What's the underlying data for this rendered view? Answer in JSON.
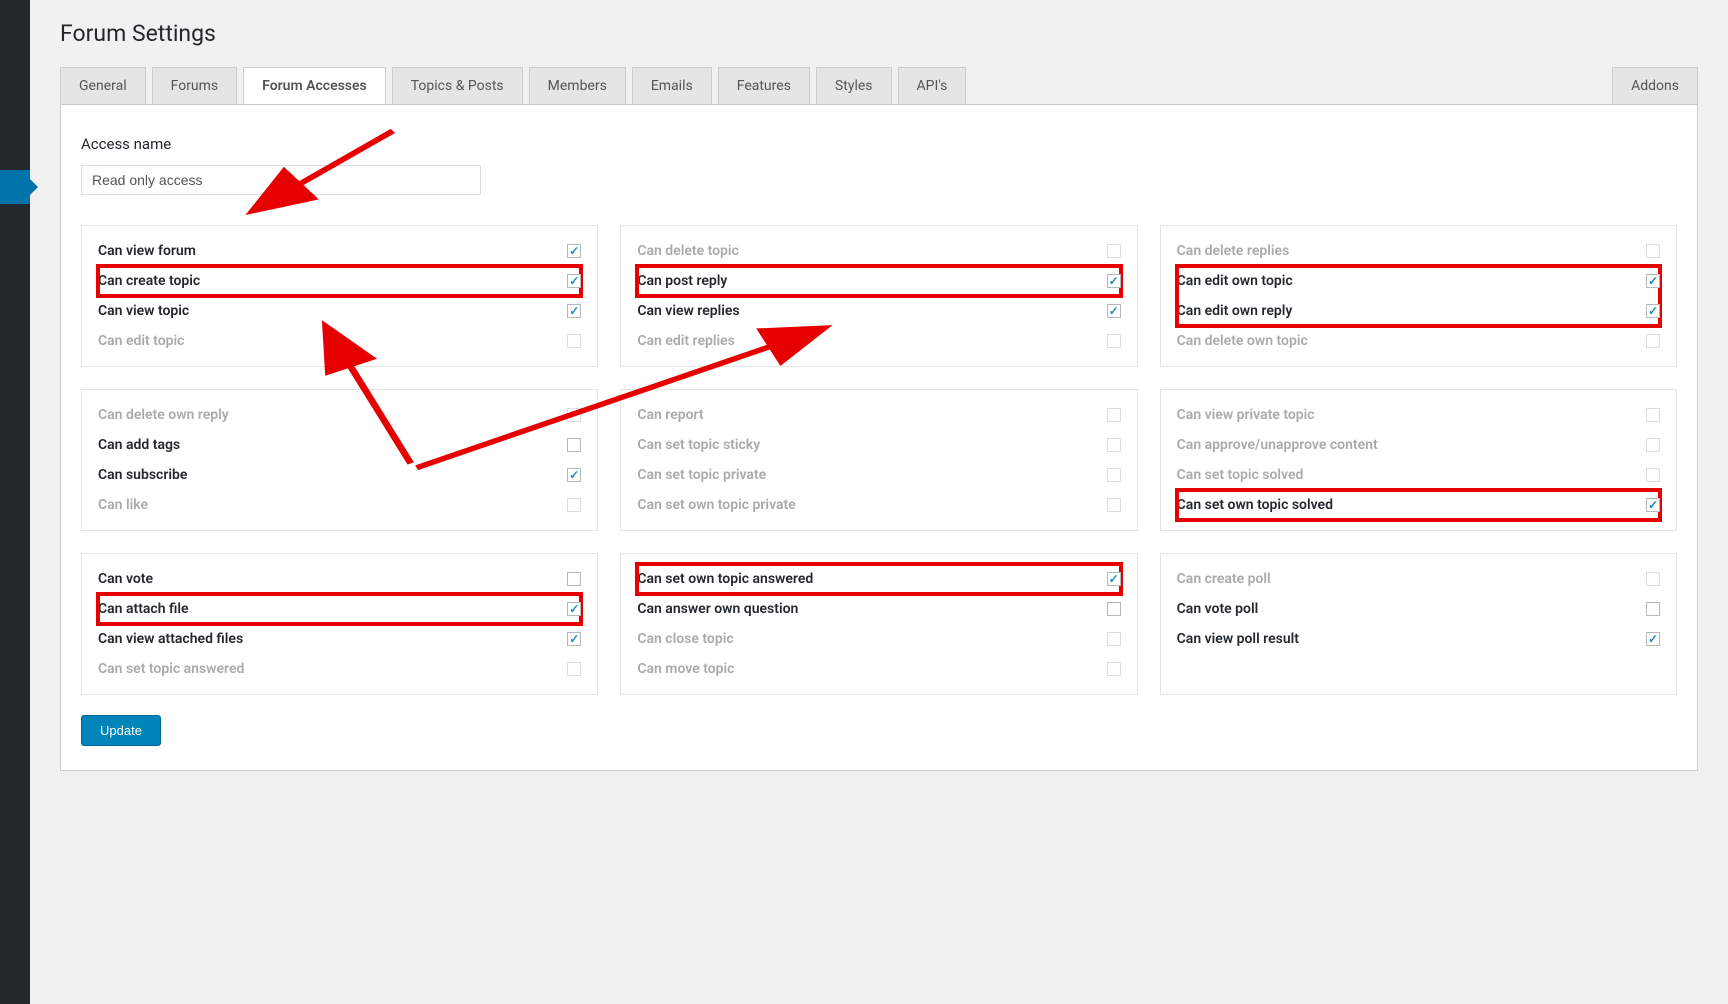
{
  "page_title": "Forum Settings",
  "tabs": {
    "general": "General",
    "forums": "Forums",
    "forum_accesses": "Forum Accesses",
    "topics_posts": "Topics & Posts",
    "members": "Members",
    "emails": "Emails",
    "features": "Features",
    "styles": "Styles",
    "apis": "API's",
    "addons": "Addons"
  },
  "access_name_label": "Access name",
  "access_name_value": "Read only access",
  "cards": [
    [
      {
        "label": "Can view forum",
        "checked": true,
        "enabled": true,
        "highlight": false
      },
      {
        "label": "Can create topic",
        "checked": true,
        "enabled": true,
        "highlight": true
      },
      {
        "label": "Can view topic",
        "checked": true,
        "enabled": true,
        "highlight": false
      },
      {
        "label": "Can edit topic",
        "checked": false,
        "enabled": false,
        "highlight": false
      }
    ],
    [
      {
        "label": "Can delete topic",
        "checked": false,
        "enabled": false,
        "highlight": false
      },
      {
        "label": "Can post reply",
        "checked": true,
        "enabled": true,
        "highlight": true
      },
      {
        "label": "Can view replies",
        "checked": true,
        "enabled": true,
        "highlight": false
      },
      {
        "label": "Can edit replies",
        "checked": false,
        "enabled": false,
        "highlight": false
      }
    ],
    [
      {
        "label": "Can delete replies",
        "checked": false,
        "enabled": false,
        "highlight": false
      },
      {
        "label": "Can edit own topic",
        "checked": true,
        "enabled": true,
        "highlight": true
      },
      {
        "label": "Can edit own reply",
        "checked": true,
        "enabled": true,
        "highlight": true
      },
      {
        "label": "Can delete own topic",
        "checked": false,
        "enabled": false,
        "highlight": false
      }
    ],
    [
      {
        "label": "Can delete own reply",
        "checked": false,
        "enabled": false,
        "highlight": false
      },
      {
        "label": "Can add tags",
        "checked": false,
        "enabled": true,
        "highlight": false
      },
      {
        "label": "Can subscribe",
        "checked": true,
        "enabled": true,
        "highlight": false
      },
      {
        "label": "Can like",
        "checked": false,
        "enabled": false,
        "highlight": false
      }
    ],
    [
      {
        "label": "Can report",
        "checked": false,
        "enabled": false,
        "highlight": false
      },
      {
        "label": "Can set topic sticky",
        "checked": false,
        "enabled": false,
        "highlight": false
      },
      {
        "label": "Can set topic private",
        "checked": false,
        "enabled": false,
        "highlight": false
      },
      {
        "label": "Can set own topic private",
        "checked": false,
        "enabled": false,
        "highlight": false
      }
    ],
    [
      {
        "label": "Can view private topic",
        "checked": false,
        "enabled": false,
        "highlight": false
      },
      {
        "label": "Can approve/unapprove content",
        "checked": false,
        "enabled": false,
        "highlight": false
      },
      {
        "label": "Can set topic solved",
        "checked": false,
        "enabled": false,
        "highlight": false
      },
      {
        "label": "Can set own topic solved",
        "checked": true,
        "enabled": true,
        "highlight": true
      }
    ],
    [
      {
        "label": "Can vote",
        "checked": false,
        "enabled": true,
        "highlight": false
      },
      {
        "label": "Can attach file",
        "checked": true,
        "enabled": true,
        "highlight": true
      },
      {
        "label": "Can view attached files",
        "checked": true,
        "enabled": true,
        "highlight": false
      },
      {
        "label": "Can set topic answered",
        "checked": false,
        "enabled": false,
        "highlight": false
      }
    ],
    [
      {
        "label": "Can set own topic answered",
        "checked": true,
        "enabled": true,
        "highlight": true
      },
      {
        "label": "Can answer own question",
        "checked": false,
        "enabled": true,
        "highlight": false
      },
      {
        "label": "Can close topic",
        "checked": false,
        "enabled": false,
        "highlight": false
      },
      {
        "label": "Can move topic",
        "checked": false,
        "enabled": false,
        "highlight": false
      }
    ],
    [
      {
        "label": "Can create poll",
        "checked": false,
        "enabled": false,
        "highlight": false
      },
      {
        "label": "Can vote poll",
        "checked": false,
        "enabled": true,
        "highlight": false
      },
      {
        "label": "Can view poll result",
        "checked": true,
        "enabled": true,
        "highlight": false
      }
    ]
  ],
  "update_button": "Update"
}
